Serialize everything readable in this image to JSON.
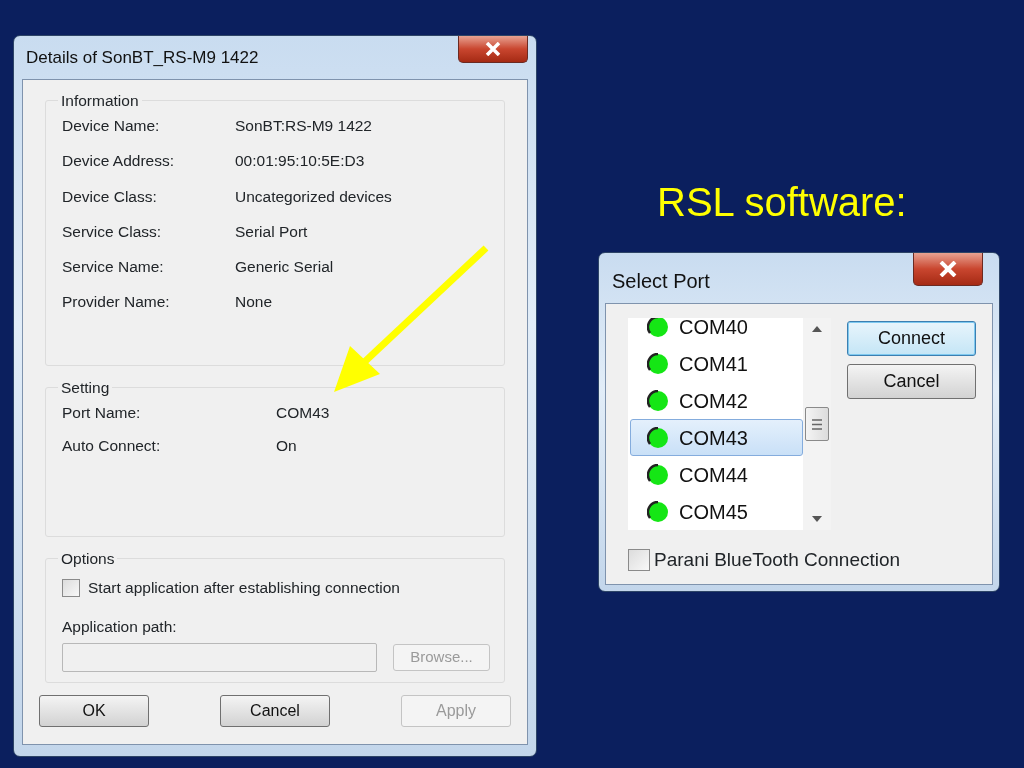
{
  "slide": {
    "heading": "RSL software:"
  },
  "details_dialog": {
    "title": "Details of SonBT_RS-M9 1422",
    "information": {
      "legend": "Information",
      "rows": [
        {
          "label": "Device Name:",
          "value": "SonBT:RS-M9 1422"
        },
        {
          "label": "Device Address:",
          "value": "00:01:95:10:5E:D3"
        },
        {
          "label": "Device Class:",
          "value": "Uncategorized devices"
        },
        {
          "label": "Service Class:",
          "value": "Serial Port"
        },
        {
          "label": "Service Name:",
          "value": "Generic Serial"
        },
        {
          "label": "Provider Name:",
          "value": "None"
        }
      ]
    },
    "setting": {
      "legend": "Setting",
      "rows": [
        {
          "label": "Port Name:",
          "value": "COM43"
        },
        {
          "label": "Auto Connect:",
          "value": "On"
        }
      ]
    },
    "options": {
      "legend": "Options",
      "start_app": {
        "label": "Start application after establishing connection",
        "checked": false
      },
      "path_label": "Application path:",
      "path_field": {
        "disabled": true
      },
      "browse": {
        "label": "Browse...",
        "disabled": true
      }
    },
    "buttons": [
      {
        "label": "OK",
        "disabled": false
      },
      {
        "label": "Cancel",
        "disabled": false
      },
      {
        "label": "Apply",
        "disabled": true
      }
    ]
  },
  "select_port_dialog": {
    "title": "Select Port",
    "ports": [
      {
        "name": "COM40",
        "selected": false
      },
      {
        "name": "COM41",
        "selected": false
      },
      {
        "name": "COM42",
        "selected": false
      },
      {
        "name": "COM43",
        "selected": true
      },
      {
        "name": "COM44",
        "selected": false
      },
      {
        "name": "COM45",
        "selected": false
      }
    ],
    "buttons": [
      {
        "label": "Connect",
        "default": true
      },
      {
        "label": "Cancel",
        "default": false
      }
    ],
    "parani": {
      "label": "Parani BlueTooth Connection",
      "checked": false
    }
  }
}
